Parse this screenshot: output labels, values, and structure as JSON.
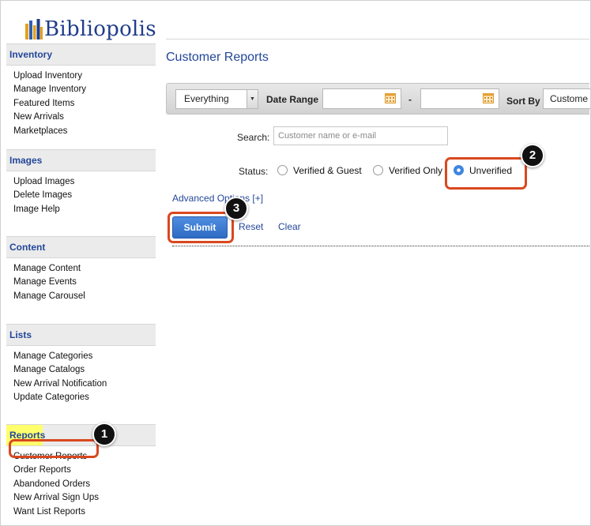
{
  "logo": {
    "text": "Bibliopolis",
    "icon": "books-icon"
  },
  "sidebar": {
    "sections": [
      {
        "title": "Inventory",
        "items": [
          "Upload Inventory",
          "Manage Inventory",
          "Featured Items",
          "New Arrivals",
          "Marketplaces"
        ]
      },
      {
        "title": "Images",
        "items": [
          "Upload Images",
          "Delete Images",
          "Image Help"
        ]
      },
      {
        "title": "Content",
        "items": [
          "Manage Content",
          "Manage Events",
          "Manage Carousel"
        ]
      },
      {
        "title": "Lists",
        "items": [
          "Manage Categories",
          "Manage Catalogs",
          "New Arrival Notification",
          "Update Categories"
        ]
      },
      {
        "title": "Reports",
        "items": [
          "Customer Reports",
          "Order Reports",
          "Abandoned Orders",
          "New Arrival Sign Ups",
          "Want List Reports"
        ]
      }
    ]
  },
  "page": {
    "title": "Customer Reports"
  },
  "filter_bar": {
    "type_select": {
      "value": "Everything"
    },
    "date_range_label": "Date Range",
    "date_separator": "-",
    "sort_label": "Sort By",
    "sort_value": "Custome"
  },
  "search": {
    "label": "Search:",
    "placeholder": "Customer name or e-mail"
  },
  "status": {
    "label": "Status:",
    "options": [
      {
        "label": "Verified & Guest",
        "selected": false
      },
      {
        "label": "Verified Only",
        "selected": false
      },
      {
        "label": "Unverified",
        "selected": true
      }
    ]
  },
  "advanced_link": "Advanced Options [+]",
  "actions": {
    "submit": "Submit",
    "reset": "Reset",
    "clear": "Clear"
  },
  "annotations": {
    "badge1": "1",
    "badge2": "2",
    "badge3": "3"
  },
  "colors": {
    "accent": "#23479a",
    "button": "#3a7bd5",
    "callout": "#d9481f",
    "highlight": "#ffff6b"
  }
}
